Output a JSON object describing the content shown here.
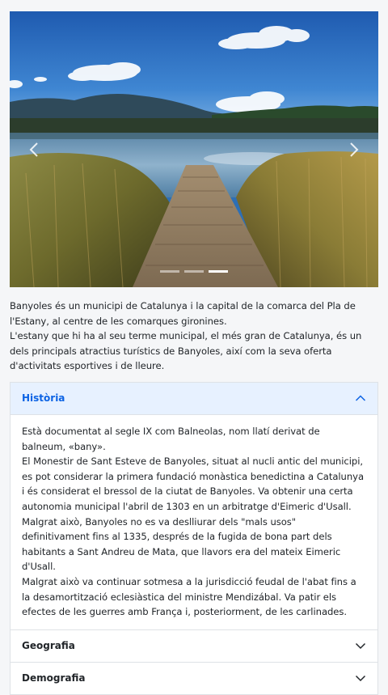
{
  "carousel": {
    "prev_label": "‹",
    "next_label": "›",
    "slide_count": 3,
    "active_index": 1
  },
  "intro": {
    "lines": [
      "Banyoles és un municipi de Catalunya i la capital de la comarca del Pla de l'Estany, al centre de les comarques gironines.",
      "L'estany que hi ha al seu terme municipal, el més gran de Catalunya, és un dels principals atractius turístics de Banyoles, així com la seva oferta d'activitats esportives i de lleure."
    ]
  },
  "accordion": {
    "historia": {
      "title": "Història",
      "expanded": true,
      "paragraphs": [
        "Està documentat al segle IX com Balneolas, nom llatí derivat de balneum, «bany».",
        "El Monestir de Sant Esteve de Banyoles, situat al nucli antic del municipi, es pot considerar la primera fundació monàstica benedictina a Catalunya i és considerat el bressol de la ciutat de Banyoles. Va obtenir una certa autonomia municipal l'abril de 1303 en un arbitratge d'Eimeric d'Usall. Malgrat això, Banyoles no es va deslliurar dels \"mals usos\" definitivament fins al 1335, després de la fugida de bona part dels habitants a Sant Andreu de Mata, que llavors era del mateix Eimeric d'Usall.",
        "Malgrat això va continuar sotmesa a la jurisdicció feudal de l'abat fins a la desamortització eclesiàstica del ministre Mendizábal. Va patir els efectes de les guerres amb França i, posteriorment, de les carlinades."
      ]
    },
    "geografia": {
      "title": "Geografia",
      "expanded": false
    },
    "demografia": {
      "title": "Demografia",
      "expanded": false
    }
  },
  "colors": {
    "accent": "#0c63e4",
    "accordion_active_bg": "#e7f1ff",
    "page_bg": "#f5f6f8"
  }
}
